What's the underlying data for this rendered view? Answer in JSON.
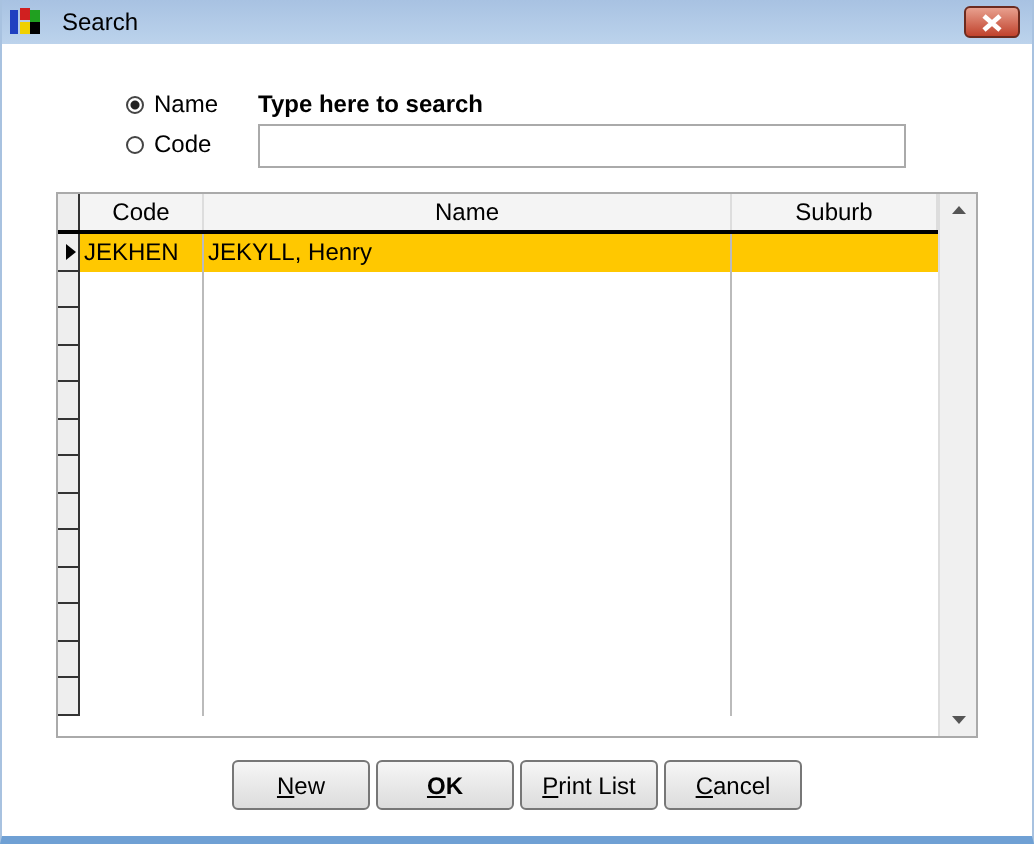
{
  "window": {
    "title": "Search"
  },
  "search_by": [
    {
      "label": "Name",
      "selected": true
    },
    {
      "label": "Code",
      "selected": false
    }
  ],
  "search": {
    "label": "Type here to search"
  },
  "table": {
    "columns": [
      "Code",
      "Name",
      "Suburb"
    ],
    "rows": [
      {
        "cells": [
          "JEKHEN",
          "JEKYLL, Henry",
          ""
        ],
        "selected": true
      }
    ]
  },
  "buttons": [
    {
      "accel": "N",
      "rest": "ew"
    },
    {
      "accel": "O",
      "rest": "K"
    },
    {
      "accel": "P",
      "rest": "rint List"
    },
    {
      "accel": "C",
      "rest": "ancel"
    }
  ]
}
